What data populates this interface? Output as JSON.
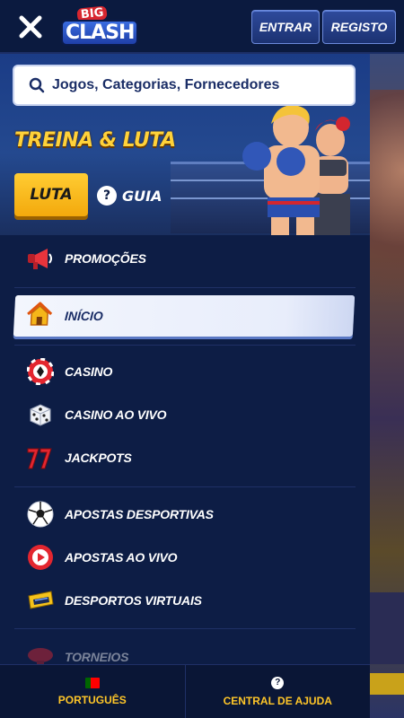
{
  "header": {
    "logo_top": "BIG",
    "logo_bottom": "CLASH",
    "login_label": "ENTRAR",
    "register_label": "REGISTO"
  },
  "search": {
    "placeholder": "Jogos, Categorias, Fornecedores"
  },
  "hero": {
    "title": "TREINA & LUTA",
    "fight_label": "LUTA",
    "guide_label": "GUIA"
  },
  "menu": {
    "promotions": "PROMOÇÕES",
    "home": "INÍCIO",
    "casino": "CASINO",
    "live_casino": "CASINO AO VIVO",
    "jackpots": "JACKPOTS",
    "sports_betting": "APOSTAS DESPORTIVAS",
    "live_betting": "APOSTAS AO VIVO",
    "virtual_sports": "DESPORTOS VIRTUAIS",
    "tournaments": "TORNEIOS"
  },
  "footer": {
    "language_label": "PORTUGUÊS",
    "help_label": "CENTRAL DE AJUDA"
  },
  "colors": {
    "background": "#0d1d45",
    "accent_yellow": "#ffc628",
    "active_item": "#e8edfb"
  }
}
